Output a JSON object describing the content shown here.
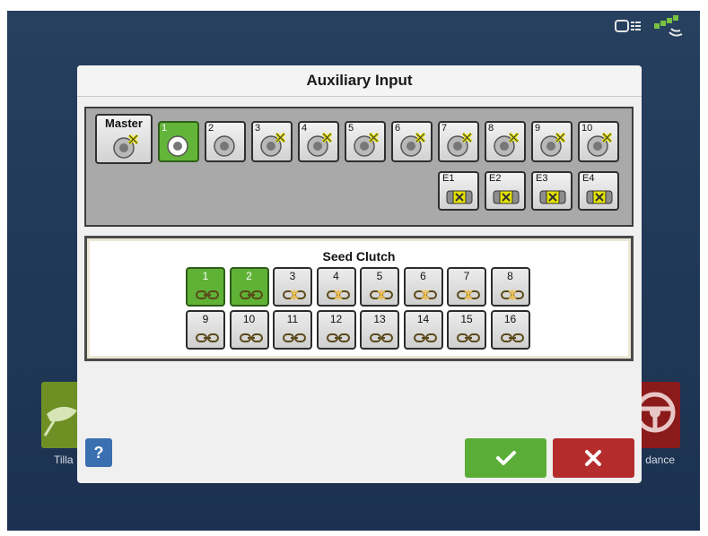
{
  "background": {
    "left_tile_label": "Tilla",
    "right_tile_label": "dance"
  },
  "dialog": {
    "title": "Auxiliary Input",
    "master_label": "Master",
    "switches": [
      "1",
      "2",
      "3",
      "4",
      "5",
      "6",
      "7",
      "8",
      "9",
      "10"
    ],
    "external": [
      "E1",
      "E2",
      "E3",
      "E4"
    ],
    "seed_clutch": {
      "title": "Seed Clutch",
      "row1": [
        "1",
        "2",
        "3",
        "4",
        "5",
        "6",
        "7",
        "8"
      ],
      "row2": [
        "9",
        "10",
        "11",
        "12",
        "13",
        "14",
        "15",
        "16"
      ]
    },
    "help_label": "?"
  },
  "colors": {
    "engaged_green": "#5fb236",
    "ok_green": "#5aae37",
    "cancel_red": "#b42c2c",
    "help_blue": "#3a6fb0"
  }
}
